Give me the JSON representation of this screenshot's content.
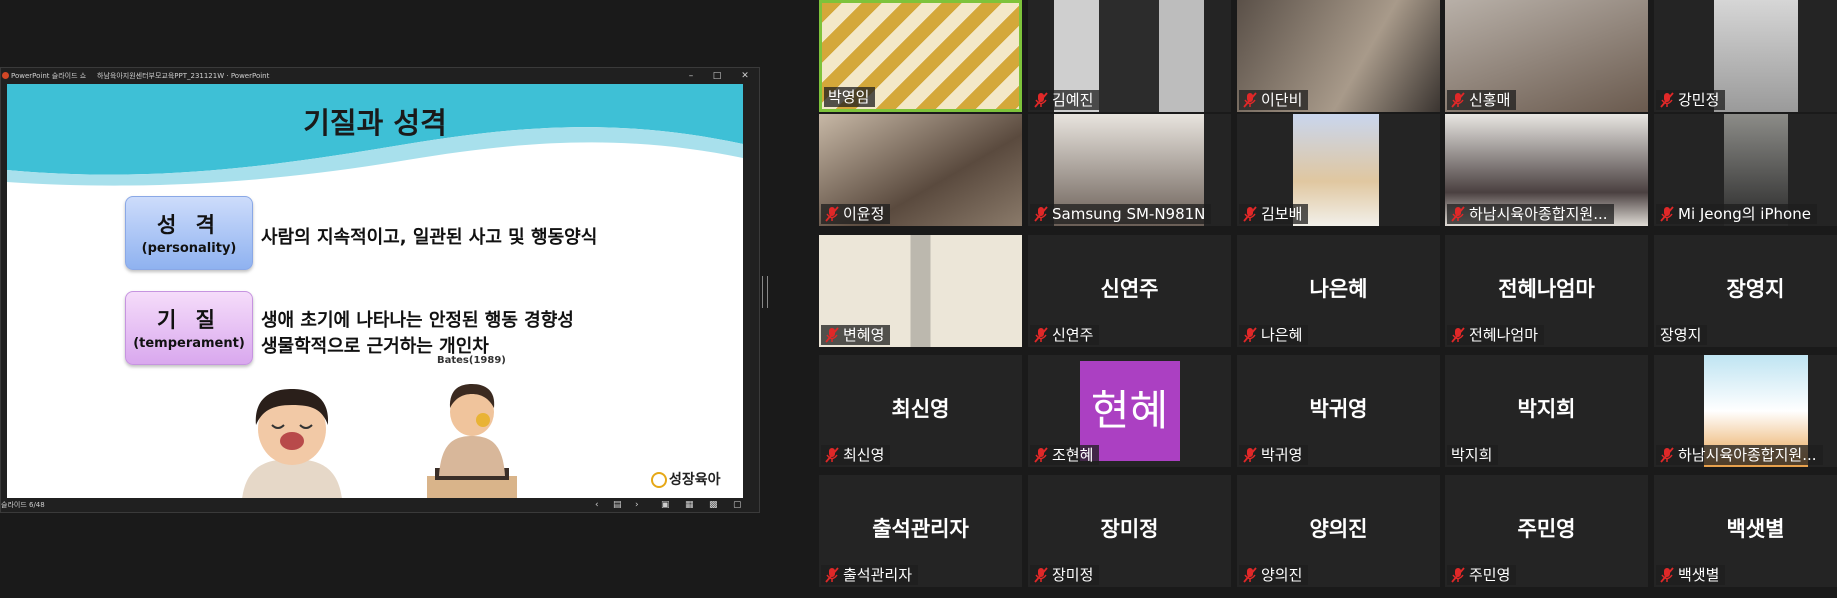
{
  "ppt": {
    "title": "PowerPoint 슬라이드 쇼",
    "document": "하남육아지원센터부모교육PPT_231121W · PowerPoint",
    "status": "슬라이드 6/48",
    "slide": {
      "title": "기질과 성격",
      "personality_term": "성 격",
      "personality_en": "(personality)",
      "personality_def": "사람의 지속적이고, 일관된 사고 및 행동양식",
      "temperament_term": "기 질",
      "temperament_en": "(temperament)",
      "temperament_def1": "생애 초기에 나타나는 안정된 행동 경향성",
      "temperament_def2": "생물학적으로 근거하는 개인차",
      "citation": "Bates(1989)",
      "logo_text": "성장육아"
    }
  },
  "participants": [
    {
      "name": "박영임",
      "muted": false,
      "video": true
    },
    {
      "name": "김예진",
      "muted": true,
      "video": true
    },
    {
      "name": "이단비",
      "muted": true,
      "video": true
    },
    {
      "name": "신홍매",
      "muted": true,
      "video": true
    },
    {
      "name": "강민정",
      "muted": true,
      "video": true
    },
    {
      "name": "이윤정",
      "muted": true,
      "video": true
    },
    {
      "name": "Samsung SM-N981N",
      "muted": true,
      "video": true
    },
    {
      "name": "김보배",
      "muted": true,
      "video": true
    },
    {
      "name": "하남시육아종합지원...",
      "muted": true,
      "video": true
    },
    {
      "name": "Mi Jeong의 iPhone",
      "muted": true,
      "video": true
    },
    {
      "name": "변혜영",
      "muted": true,
      "video": true
    },
    {
      "name": "신연주",
      "big": "신연주",
      "muted": true,
      "video": false
    },
    {
      "name": "나은혜",
      "big": "나은혜",
      "muted": true,
      "video": false
    },
    {
      "name": "전혜나엄마",
      "big": "전혜나엄마",
      "muted": true,
      "video": false
    },
    {
      "name": "장영지",
      "big": "장영지",
      "muted": false,
      "video": false
    },
    {
      "name": "최신영",
      "big": "최신영",
      "muted": true,
      "video": false
    },
    {
      "name": "조현혜",
      "avatar": "현혜",
      "muted": true,
      "video": false
    },
    {
      "name": "박귀영",
      "big": "박귀영",
      "muted": true,
      "video": false
    },
    {
      "name": "박지희",
      "big": "박지희",
      "muted": false,
      "video": false
    },
    {
      "name": "하남시육아종합지원...",
      "muted": true,
      "video": true
    },
    {
      "name": "출석관리자",
      "big": "출석관리자",
      "muted": true,
      "video": false
    },
    {
      "name": "장미정",
      "big": "장미정",
      "muted": true,
      "video": false
    },
    {
      "name": "양의진",
      "big": "양의진",
      "muted": true,
      "video": false
    },
    {
      "name": "주민영",
      "big": "주민영",
      "muted": true,
      "video": false
    },
    {
      "name": "백샛별",
      "big": "백샛별",
      "muted": true,
      "video": false
    }
  ],
  "colors": {
    "active_speaker_border": "#7ec33b",
    "mute_icon": "#e02828",
    "slide_wave": "#3ec0d6",
    "avatar_bg": "#ab40c2"
  }
}
